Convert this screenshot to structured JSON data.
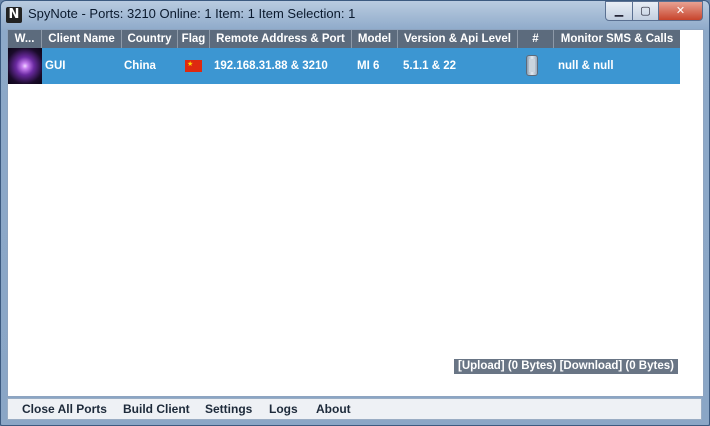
{
  "window": {
    "icon_glyph": "N",
    "title": "SpyNote - Ports: 3210 Online: 1 Item: 1 Item Selection: 1",
    "minimize_glyph": "▁",
    "maximize_glyph": "▢",
    "close_glyph": "✕"
  },
  "table": {
    "columns": [
      "W...",
      "Client Name",
      "Country",
      "Flag",
      "Remote Address & Port",
      "Model",
      "Version & Api Level",
      "#",
      "Monitor SMS & Calls"
    ],
    "rows": [
      {
        "client_name": "GUI",
        "country": "China",
        "flag_icon": "china-flag-icon",
        "remote": "192.168.31.88 & 3210",
        "model": "MI 6",
        "version": "5.1.1 & 22",
        "device_icon": "phone-icon",
        "monitor": "null & null"
      }
    ]
  },
  "status": {
    "transfer": "[Upload] (0 Bytes) [Download] (0 Bytes)"
  },
  "menu": {
    "items": [
      "Close All Ports",
      "Build Client",
      "Settings",
      "Logs",
      "About"
    ]
  },
  "colors": {
    "selected_row": "#3c96d2",
    "header": "#5c6b7d",
    "status_bg": "#697585"
  }
}
